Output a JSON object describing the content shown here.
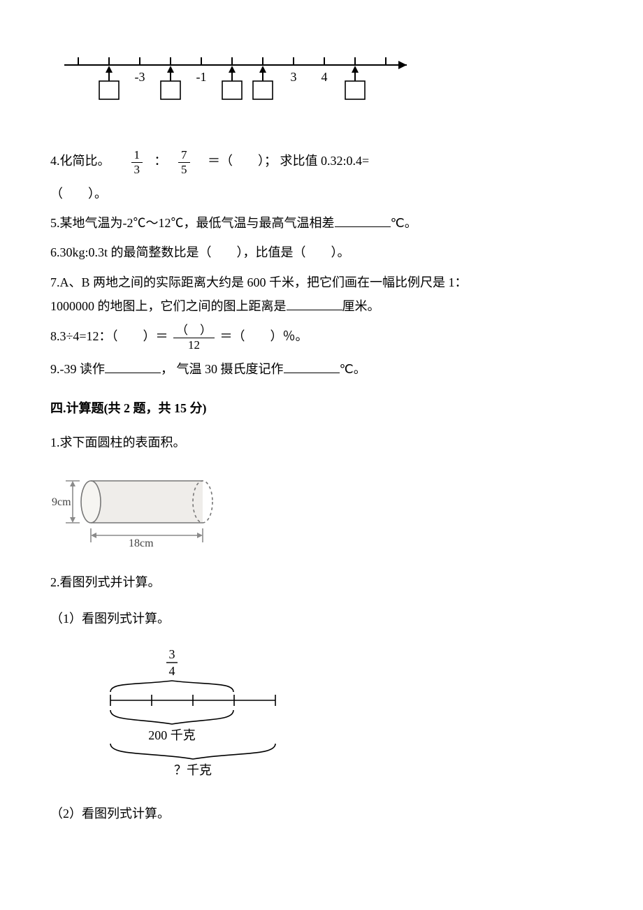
{
  "numLine": {
    "visibleLabels": [
      "-3",
      "-1",
      "3",
      "4"
    ]
  },
  "q4": {
    "prefix": "4.化简比。",
    "f1_num": "1",
    "f1_den": "3",
    "colon": "：",
    "f2_num": "7",
    "f2_den": "5",
    "eq": "＝（　　）； 求比值 0.32:0.4=",
    "line2": "（　　）。"
  },
  "q5": "5.某地气温为-2℃～12℃，最低气温与最高气温相差",
  "q5_suffix": "℃。",
  "q6": "6.30kg:0.3t 的最简整数比是（　　），比值是（　　）。",
  "q7_a": "7.A、B 两地之间的实际距离大约是 600 千米，把它们画在一幅比例尺是 1：",
  "q7_b": "1000000 的地图上，它们之间的图上距离是",
  "q7_c": "厘米。",
  "q8": {
    "prefix": "8.3÷4=12：（　　）＝ ",
    "num": "（　）",
    "den": "12",
    "suffix": " ＝（　　）％。"
  },
  "q9_a": "9.-39 读作",
  "q9_b": "，  气温 30 摄氏度记作",
  "q9_c": "℃。",
  "sec4_title": "四.计算题(共 2 题，共 15 分)",
  "c1": "1.求下面圆柱的表面积。",
  "cyl": {
    "h": "9cm",
    "w": "18cm"
  },
  "c2": "2.看图列式并计算。",
  "c2_1": "（1）看图列式计算。",
  "brace1": {
    "top": "3",
    "top_den": "4",
    "mid": "200 千克",
    "bot": "？千克"
  },
  "c2_2": "（2）看图列式计算。"
}
